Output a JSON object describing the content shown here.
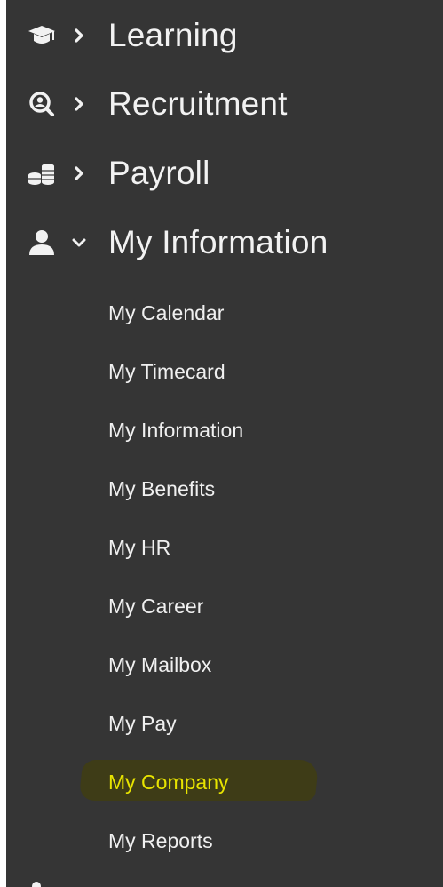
{
  "sidebar": {
    "sections": [
      {
        "label": "Learning",
        "icon": "graduation-cap-icon",
        "expanded": false
      },
      {
        "label": "Recruitment",
        "icon": "search-person-icon",
        "expanded": false
      },
      {
        "label": "Payroll",
        "icon": "coins-stack-icon",
        "expanded": false
      },
      {
        "label": "My Information",
        "icon": "user-icon",
        "expanded": true
      }
    ],
    "submenu": [
      {
        "label": "My Calendar"
      },
      {
        "label": "My Timecard"
      },
      {
        "label": "My Information"
      },
      {
        "label": "My Benefits"
      },
      {
        "label": "My HR"
      },
      {
        "label": "My Career"
      },
      {
        "label": "My Mailbox"
      },
      {
        "label": "My Pay"
      },
      {
        "label": "My Company",
        "active": true
      },
      {
        "label": "My Reports"
      }
    ]
  },
  "colors": {
    "sidebar_bg": "#353535",
    "text": "#f2f2f2",
    "active_text": "#e8e400",
    "active_highlight": "#3e3c17"
  }
}
